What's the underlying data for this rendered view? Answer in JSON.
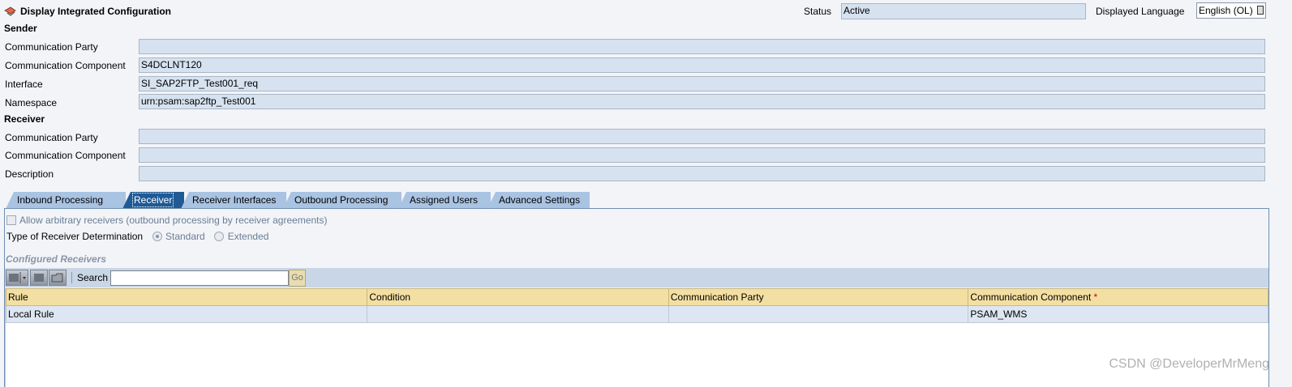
{
  "header": {
    "title": "Display Integrated Configuration",
    "status_label": "Status",
    "status_value": "Active",
    "language_label": "Displayed Language",
    "language_value": "English (OL)"
  },
  "sender": {
    "heading": "Sender",
    "party_label": "Communication Party",
    "party_value": "",
    "component_label": "Communication Component",
    "component_value": "S4DCLNT120",
    "interface_label": "Interface",
    "interface_value": "SI_SAP2FTP_Test001_req",
    "namespace_label": "Namespace",
    "namespace_value": "urn:psam:sap2ftp_Test001"
  },
  "receiver": {
    "heading": "Receiver",
    "party_label": "Communication Party",
    "party_value": "",
    "component_label": "Communication Component",
    "component_value": "",
    "description_label": "Description",
    "description_value": ""
  },
  "tabs": [
    {
      "label": "Inbound Processing",
      "active": false
    },
    {
      "label": "Receiver",
      "active": true
    },
    {
      "label": "Receiver Interfaces",
      "active": false
    },
    {
      "label": "Outbound Processing",
      "active": false
    },
    {
      "label": "Assigned Users",
      "active": false
    },
    {
      "label": "Advanced Settings",
      "active": false
    }
  ],
  "receiver_tab": {
    "allow_arbitrary_label": "Allow arbitrary receivers (outbound processing by receiver agreements)",
    "determination_label": "Type of Receiver Determination",
    "option_standard": "Standard",
    "option_extended": "Extended",
    "selected_option": "Standard",
    "configured_title": "Configured Receivers",
    "search_label": "Search",
    "search_value": "",
    "go_label": "Go"
  },
  "grid": {
    "columns": [
      "Rule",
      "Condition",
      "Communication Party",
      "Communication Component"
    ],
    "required_mark": "*",
    "rows": [
      [
        "Local Rule",
        "",
        "",
        "PSAM_WMS"
      ]
    ]
  },
  "watermark": "CSDN @DeveloperMrMeng",
  "colors": {
    "active_tab": "#1f5a95",
    "inactive_tab": "#a9c3e2",
    "field_bg": "#d6e2f0",
    "grid_header": "#f4dfa2"
  }
}
